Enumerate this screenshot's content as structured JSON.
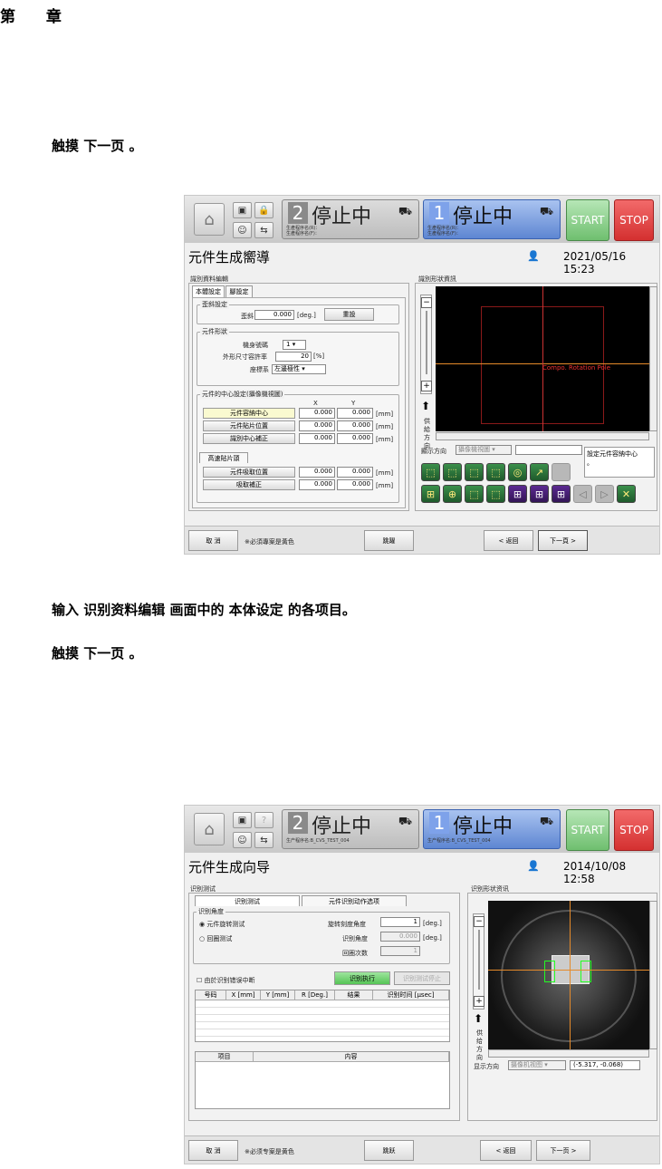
{
  "chapter": "第 章",
  "instr1": "触摸 下一页 。",
  "instr2": "输入 识别资料编辑 画面中的 本体设定 的各项目。",
  "instr3": "触摸 下一页 。",
  "s1": {
    "status2": {
      "num": "2",
      "text": "停止中",
      "prog_r": "生產程序名(R)：",
      "prog_f": "生產程序名(F)："
    },
    "status1": {
      "num": "1",
      "text": "停止中",
      "prog_r": "生產程序名(R)：",
      "prog_f": "生產程序名(F)："
    },
    "start": "START",
    "stop": "STOP",
    "title": "元件生成嚮導",
    "datetime": "2021/05/16 15:23",
    "left_title": "識別資料編輯",
    "tabs": [
      "本體設定",
      "腳設定"
    ],
    "tilt": {
      "title": "歪斜設定",
      "label": "歪斜",
      "value": "0.000",
      "unit": "[deg.]",
      "reset": "重設"
    },
    "shape": {
      "title": "元件形狀",
      "nozzle_label": "機身號碼",
      "nozzle_value": "1",
      "tol_label": "外形尺寸容許率",
      "tol_value": "20",
      "tol_unit": "[%]",
      "coord_label": "座標系",
      "coord_value": "左邊極性"
    },
    "center": {
      "title": "元件的中心設定(攝像機視圖)",
      "x": "X",
      "y": "Y",
      "rows": [
        {
          "label": "元件容納中心",
          "x": "0.000",
          "y": "0.000",
          "unit": "[mm]"
        },
        {
          "label": "元件貼片位置",
          "x": "0.000",
          "y": "0.000",
          "unit": "[mm]"
        },
        {
          "label": "識別中心補正",
          "x": "0.000",
          "y": "0.000",
          "unit": "[mm]"
        }
      ],
      "hs_tab": "高速貼片頭",
      "rows2": [
        {
          "label": "元件吸取位置",
          "x": "0.000",
          "y": "0.000",
          "unit": "[mm]"
        },
        {
          "label": "吸取補正",
          "x": "0.000",
          "y": "0.000",
          "unit": "[mm]"
        }
      ]
    },
    "right_title": "識別形狀資訊",
    "view_label": "Compo. Rotation Pole",
    "supply": "供給方向",
    "display_dir_label": "顯示方向",
    "display_dir_value": "攝像機視圖",
    "hint": "設定元件容納中心",
    "hint2": "。",
    "bottom": {
      "cancel": "取 消",
      "note": "※必須專案是黃色",
      "skip": "跳躍",
      "back": "< 返回",
      "next": "下一頁 >"
    }
  },
  "s2": {
    "status2": {
      "num": "2",
      "text": "停止中",
      "prog": "生产程序名:B_CVS_TEST_004"
    },
    "status1": {
      "num": "1",
      "text": "停止中",
      "prog": "生产程序名:B_CVS_TEST_004"
    },
    "start": "START",
    "stop": "STOP",
    "title": "元件生成向导",
    "datetime": "2014/10/08 12:58",
    "left_title": "识别测试",
    "tabs": [
      "识别测试",
      "元件识别动作选项"
    ],
    "angle": {
      "title": "识别角度",
      "opt1": "元件旋转测试",
      "opt2": "回圈测试",
      "rot_label": "旋转刻度角度",
      "rot_value": "1",
      "rot_unit": "[deg.]",
      "rec_label": "识别角度",
      "rec_value": "0.000",
      "rec_unit": "[deg.]",
      "loop_label": "回圈次数",
      "loop_value": "1"
    },
    "stop_on_err": "由於识别错误中断",
    "exec": "识别执行",
    "stop_test": "识别测试停止",
    "cols": [
      "号码",
      "X [mm]",
      "Y [mm]",
      "R [Deg.]",
      "结果",
      "识别时间 [μsec]"
    ],
    "cols2": [
      "项目",
      "内容"
    ],
    "right_title": "识别形状资讯",
    "supply": "供给方向",
    "display_dir_label": "显示方向",
    "display_dir_value": "摄像机视图",
    "coord": "(-5.317, -0.068)",
    "bottom": {
      "cancel": "取 消",
      "note": "※必须专案是黄色",
      "skip": "跳跃",
      "back": "< 返回",
      "next": "下一页 >"
    }
  },
  "icons": [
    "home-icon",
    "keyboard-icon",
    "lock-icon",
    "help-icon",
    "user-icon",
    "transfer-icon",
    "machine-icon"
  ]
}
